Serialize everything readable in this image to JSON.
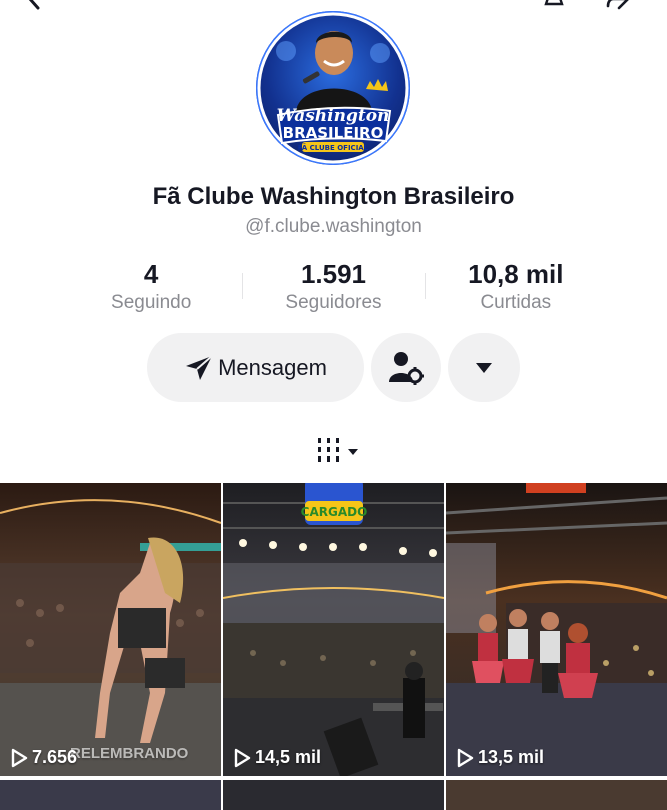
{
  "profile": {
    "name": "Fã Clube Washington Brasileiro",
    "handle": "@f.clube.washington",
    "avatar": {
      "title_line1": "Washington",
      "title_line2": "BRASILEIRO",
      "subtitle": "FÃ CLUBE OFICIAL"
    }
  },
  "stats": [
    {
      "value": "4",
      "label": "Seguindo"
    },
    {
      "value": "1.591",
      "label": "Seguidores"
    },
    {
      "value": "10,8 mil",
      "label": "Curtidas"
    }
  ],
  "actions": {
    "message_label": "Mensagem",
    "message_icon": "send-icon",
    "user_settings_icon": "user-settings-icon",
    "more_icon": "chevron-down-icon"
  },
  "tabs": {
    "grid_icon": "grid-icon"
  },
  "videos": [
    {
      "views": "7.656",
      "overlay": "RELEMBRANDO"
    },
    {
      "views": "14,5 mil",
      "overlay": "SOLTEIRO TO CARGADO"
    },
    {
      "views": "13,5 mil",
      "overlay": ""
    }
  ],
  "colors": {
    "accent_blue": "#1f5ee8",
    "text_primary": "#161823",
    "text_secondary": "#8a8b91",
    "button_bg": "#f1f1f2"
  }
}
